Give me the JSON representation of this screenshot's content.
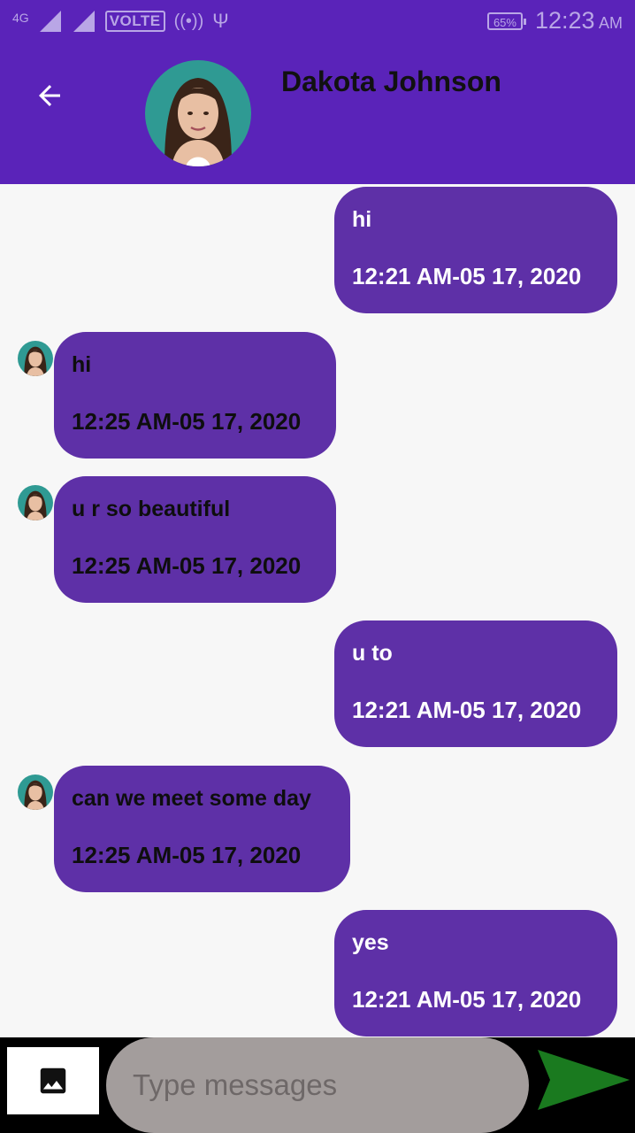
{
  "status_bar": {
    "network": "4G",
    "volte": "VOLTE",
    "hotspot": "((•))",
    "usb": "Ψ",
    "battery": "65%",
    "time": "12:23",
    "ampm": "AM"
  },
  "header": {
    "back_icon": "arrow-left-icon",
    "contact_name": "Dakota Johnson"
  },
  "messages": [
    {
      "direction": "out",
      "text": "hi",
      "time": "12:21 AM-05 17, 2020"
    },
    {
      "direction": "in",
      "text": "hi",
      "time": "12:25 AM-05 17, 2020"
    },
    {
      "direction": "in",
      "text": "u r so beautiful",
      "time": "12:25 AM-05 17, 2020"
    },
    {
      "direction": "out",
      "text": "u to",
      "time": "12:21 AM-05 17, 2020"
    },
    {
      "direction": "in",
      "text": "can we meet some day",
      "time": "12:25 AM-05 17, 2020"
    },
    {
      "direction": "out",
      "text": "yes",
      "time": "12:21 AM-05 17, 2020"
    }
  ],
  "composer": {
    "image_icon": "image-icon",
    "placeholder": "Type messages",
    "send_icon": "send-icon"
  },
  "colors": {
    "primary": "#5a23b9",
    "bubble": "#5e30a7",
    "send": "#1a7a1f"
  }
}
